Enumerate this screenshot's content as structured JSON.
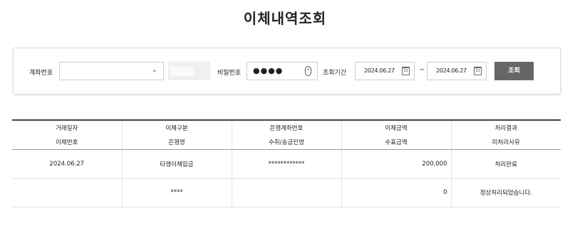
{
  "page": {
    "title": "이체내역조회"
  },
  "search": {
    "account_label": "계좌번호",
    "account_value": "",
    "password_label": "비밀번호",
    "password_masked": "●●●●",
    "period_label": "조회기간",
    "date_from": "2024.06.27",
    "date_to": "2024.06.27",
    "calendar_day": "31",
    "range_separator": "~",
    "search_button": "조회"
  },
  "table": {
    "headers_row1": [
      "거래일자",
      "이체구분",
      "은행계좌번호",
      "이체금액",
      "처리결과"
    ],
    "headers_row2": [
      "이체번호",
      "은행명",
      "수취/송금인명",
      "수표금액",
      "미처리사유"
    ],
    "rows": [
      {
        "date": "2024.06.27",
        "type": "타행이체입금",
        "account": "************",
        "amount": "200,000",
        "result": "처리완료"
      },
      {
        "transfer_no": "",
        "bank": "****",
        "name": "",
        "check_amount": "0",
        "reason": "정상처리되었습니다."
      }
    ]
  }
}
